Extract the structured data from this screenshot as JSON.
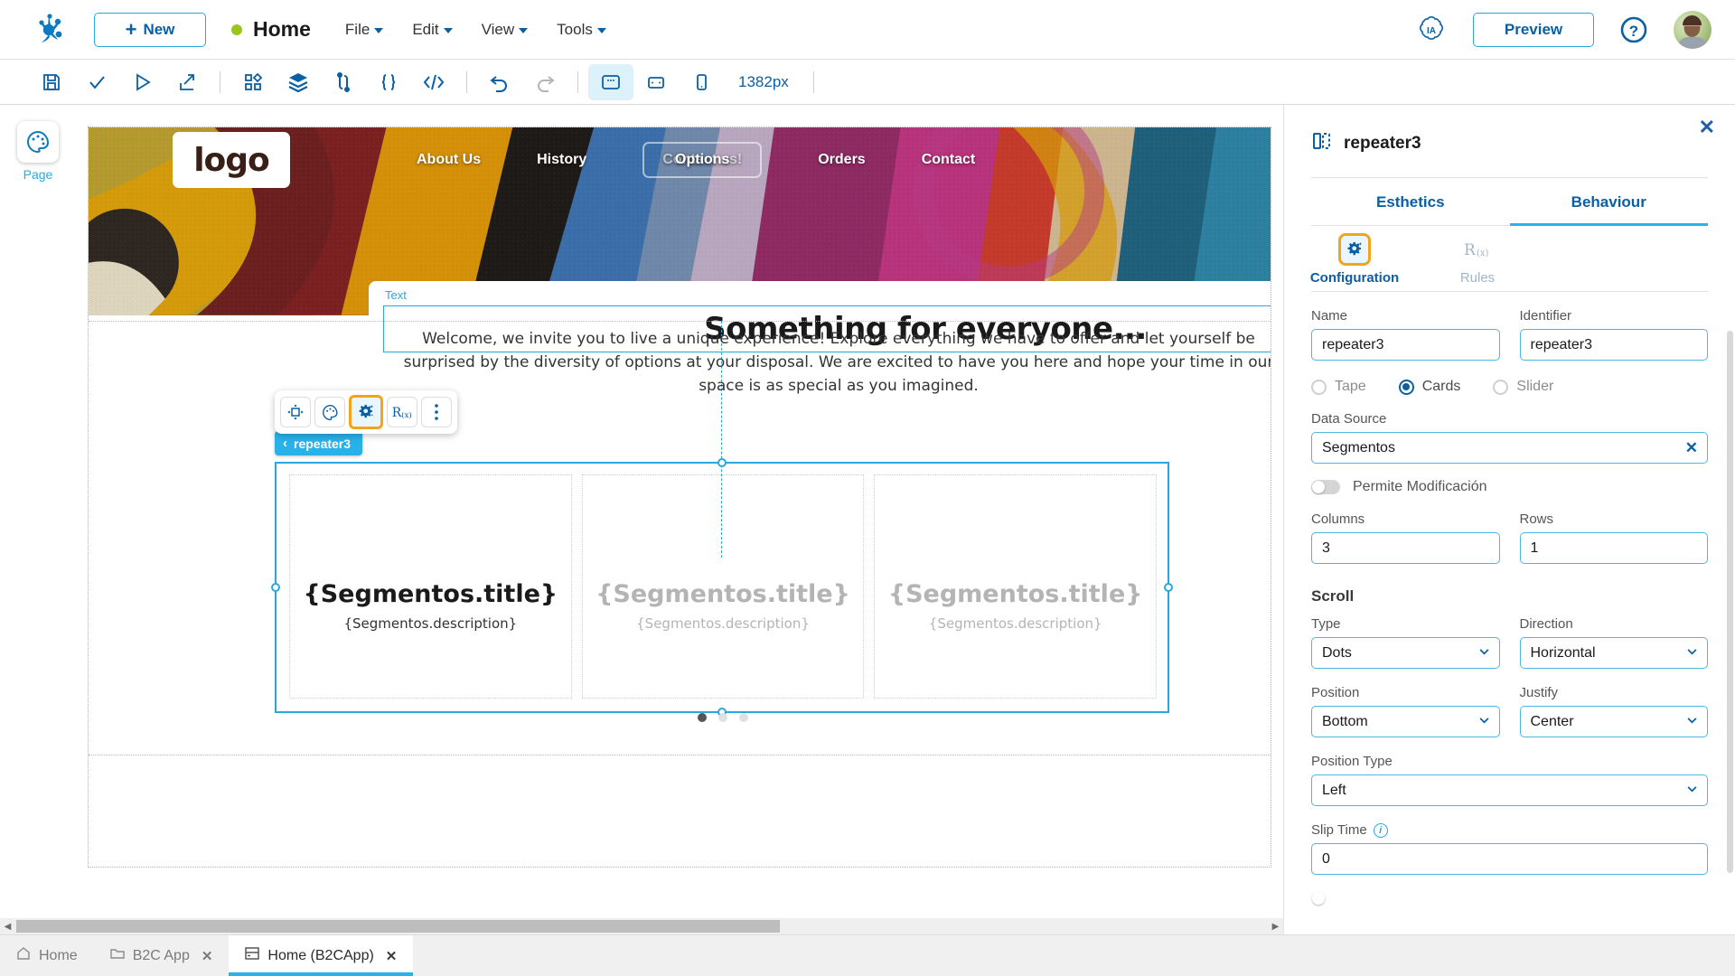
{
  "topbar": {
    "logo_icon": "genexus-logo-icon",
    "new_button": "New",
    "page_title": "Home",
    "menus": [
      "File",
      "Edit",
      "View",
      "Tools"
    ],
    "ia_badge": "IA",
    "preview_button": "Preview",
    "help_icon": "question-circle-icon",
    "avatar": "user-avatar"
  },
  "toolbar": {
    "icons": [
      "save-icon",
      "check-icon",
      "run-icon",
      "export-icon",
      "components-icon",
      "layers-icon",
      "variables-icon",
      "braces-icon",
      "code-icon",
      "undo-icon",
      "redo-icon",
      "desktop-icon",
      "tablet-icon",
      "mobile-icon"
    ],
    "zoom_value": "1382px"
  },
  "left_rail": {
    "items": [
      {
        "label": "Page",
        "icon": "palette-icon"
      }
    ]
  },
  "canvas": {
    "site": {
      "logo_text": "logo",
      "nav_links": [
        "About Us",
        "History",
        "Orders",
        "Contact"
      ],
      "contact_button": "Contact us!",
      "options_overlay": "Options",
      "text_tag": "Text",
      "headline": "Something for everyone...",
      "paragraph": "Welcome, we invite you to live a unique experience! Explore everything we have to offer and let yourself be surprised by the diversity of options at your disposal. We are excited to have you here and hope your time in our space is as special as you imagined.",
      "cards": [
        {
          "title": "{Segmentos.title}",
          "description": "{Segmentos.description}"
        },
        {
          "title": "{Segmentos.title}",
          "description": "{Segmentos.description}"
        },
        {
          "title": "{Segmentos.title}",
          "description": "{Segmentos.description}"
        }
      ],
      "dots": [
        true,
        false,
        false
      ]
    },
    "selection": {
      "label": "repeater3",
      "float_toolbar": [
        "move-icon",
        "palette-icon",
        "settings-gear-icon",
        "rules-icon",
        "more-options-icon"
      ]
    }
  },
  "right_panel": {
    "title": "repeater3",
    "title_icon": "repeater-icon",
    "close_icon": "close-icon",
    "tabs": [
      {
        "label": "Esthetics",
        "active": false
      },
      {
        "label": "Behaviour",
        "active": true
      }
    ],
    "subtabs": [
      {
        "label": "Configuration",
        "icon": "settings-gear-icon",
        "active": true
      },
      {
        "label": "Rules",
        "icon": "rules-icon",
        "active": false
      }
    ],
    "fields": {
      "name_label": "Name",
      "name_value": "repeater3",
      "identifier_label": "Identifier",
      "identifier_value": "repeater3",
      "layout_options": [
        {
          "label": "Tape",
          "selected": false
        },
        {
          "label": "Cards",
          "selected": true
        },
        {
          "label": "Slider",
          "selected": false
        }
      ],
      "data_source_label": "Data Source",
      "data_source_value": "Segmentos",
      "permite_modificacion_label": "Permite Modificación",
      "permite_modificacion_on": false,
      "columns_label": "Columns",
      "columns_value": "3",
      "rows_label": "Rows",
      "rows_value": "1"
    },
    "scroll": {
      "section_title": "Scroll",
      "type_label": "Type",
      "type_value": "Dots",
      "direction_label": "Direction",
      "direction_value": "Horizontal",
      "position_label": "Position",
      "position_value": "Bottom",
      "justify_label": "Justify",
      "justify_value": "Center",
      "position_type_label": "Position Type",
      "position_type_value": "Left",
      "slip_time_label": "Slip Time",
      "slip_time_value": "0"
    }
  },
  "bottom_tabs": [
    {
      "label": "Home",
      "icon": "home-icon",
      "active": false,
      "closable": false
    },
    {
      "label": "B2C App",
      "icon": "folder-icon",
      "active": false,
      "closable": true
    },
    {
      "label": "Home (B2CApp)",
      "icon": "panel-icon",
      "active": true,
      "closable": true
    }
  ],
  "colors": {
    "accent": "#29b1ea",
    "primary_blue": "#0b5fa5",
    "highlight_orange": "#f5a31a",
    "status_green": "#9ac61c"
  }
}
